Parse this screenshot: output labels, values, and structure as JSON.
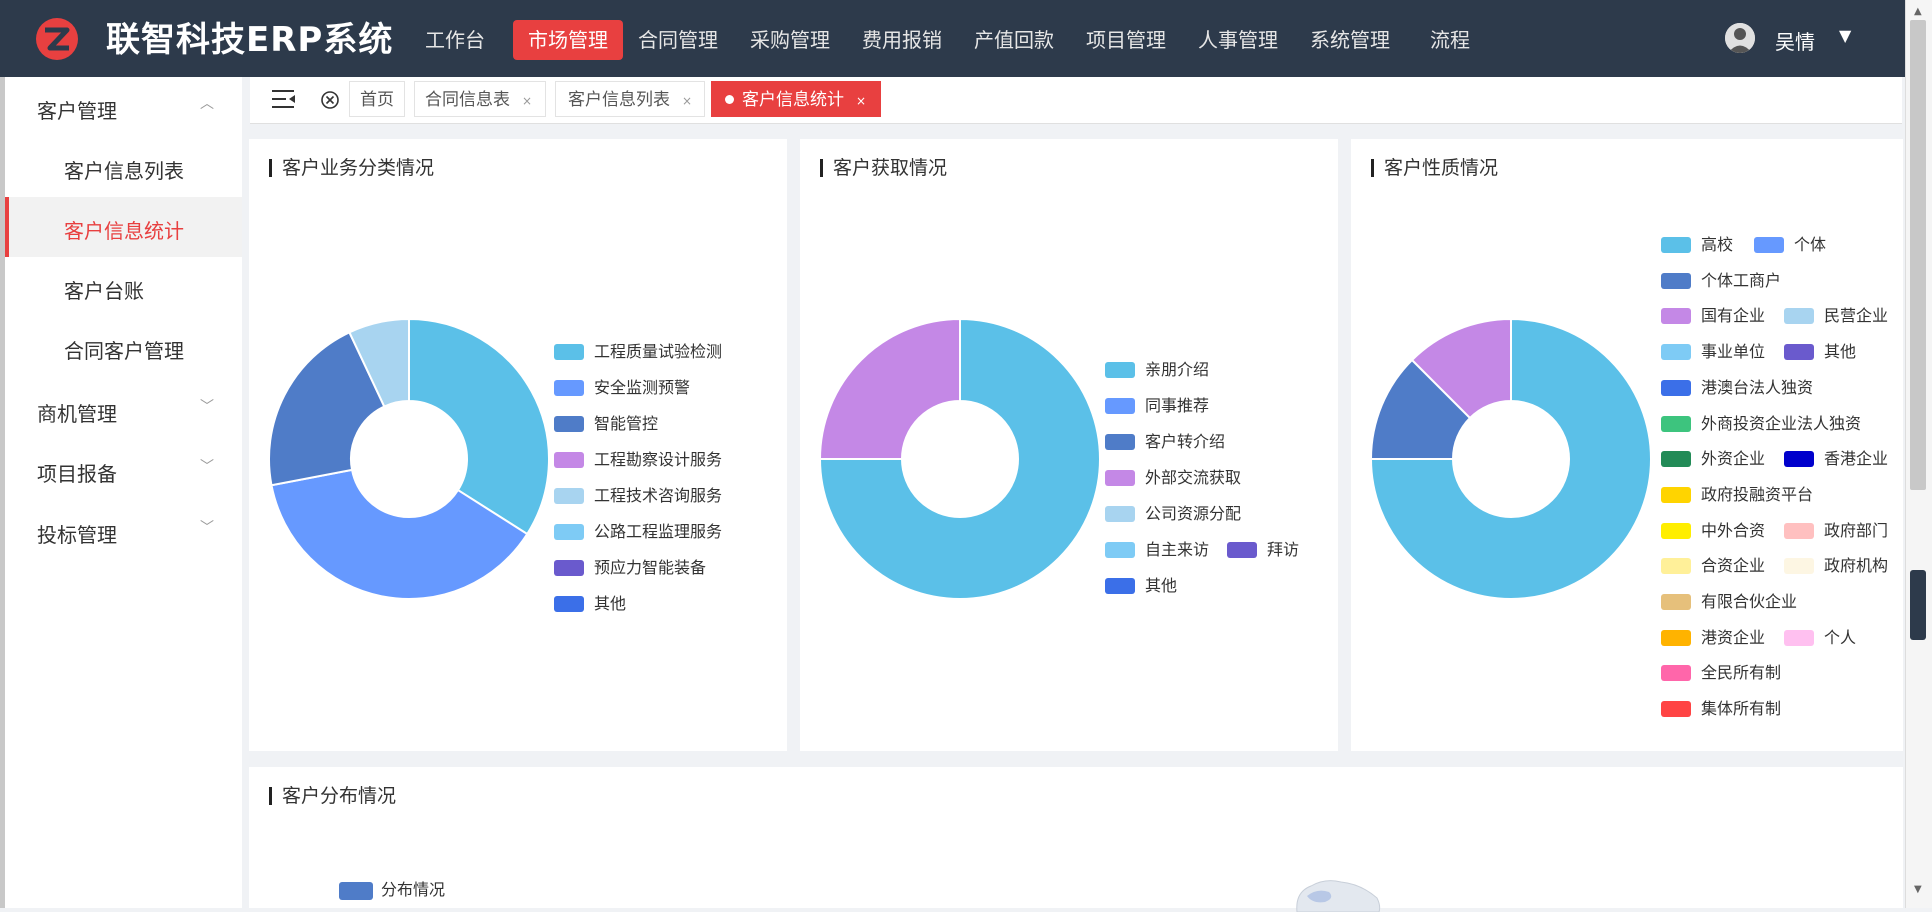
{
  "app": {
    "logo_text": "联智科技ERP系统"
  },
  "nav": {
    "items": [
      "工作台",
      "市场管理",
      "合同管理",
      "采购管理",
      "费用报销",
      "产值回款",
      "项目管理",
      "人事管理",
      "系统管理",
      "流程"
    ],
    "active_index": 1
  },
  "user": {
    "name": "吴情"
  },
  "sidebar": {
    "groups": [
      {
        "label": "客户管理",
        "expanded": true,
        "items": [
          "客户信息列表",
          "客户信息统计",
          "客户台账",
          "合同客户管理"
        ],
        "active_index": 1
      },
      {
        "label": "商机管理",
        "expanded": false
      },
      {
        "label": "项目报备",
        "expanded": false
      },
      {
        "label": "投标管理",
        "expanded": false
      }
    ]
  },
  "tabs": {
    "items": [
      "首页",
      "合同信息表",
      "客户信息列表",
      "客户信息统计"
    ],
    "active_index": 3
  },
  "colors": {
    "accent": "#e84040",
    "topbar": "#2d3a4b"
  },
  "charts": {
    "business": {
      "title": "客户业务分类情况",
      "chart_data": {
        "type": "pie",
        "donut": true,
        "categories": [
          "工程质量试验检测",
          "安全监测预警",
          "智能管控",
          "工程勘察设计服务",
          "工程技术咨询服务",
          "公路工程监理服务",
          "预应力智能装备",
          "其他"
        ],
        "values": [
          34,
          38,
          21,
          0,
          7,
          0,
          0,
          0
        ],
        "colors": [
          "#5bc0e8",
          "#6699ff",
          "#4f7cc8",
          "#c488e6",
          "#a8d4f0",
          "#7ecbf5",
          "#6a5acd",
          "#3b6fe8"
        ]
      }
    },
    "acquisition": {
      "title": "客户获取情况",
      "chart_data": {
        "type": "pie",
        "donut": true,
        "categories": [
          "亲朋介绍",
          "同事推荐",
          "客户转介绍",
          "外部交流获取",
          "公司资源分配",
          "自主来访",
          "拜访",
          "其他"
        ],
        "values": [
          75,
          0,
          0,
          25,
          0,
          0,
          0,
          0
        ],
        "colors": [
          "#5bc0e8",
          "#6699ff",
          "#4f7cc8",
          "#c488e6",
          "#a8d4f0",
          "#7ecbf5",
          "#6a5acd",
          "#3b6fe8"
        ]
      }
    },
    "nature": {
      "title": "客户性质情况",
      "chart_data": {
        "type": "pie",
        "donut": true,
        "categories": [
          "高校",
          "个体",
          "个体工商户",
          "国有企业",
          "民营企业",
          "事业单位",
          "其他",
          "港澳台法人独资",
          "外商投资企业法人独资",
          "外资企业",
          "香港企业",
          "政府投融资平台",
          "中外合资",
          "政府部门",
          "合资企业",
          "政府机构",
          "有限合伙企业",
          "港资企业",
          "个人",
          "全民所有制",
          "集体所有制"
        ],
        "values": [
          75,
          0,
          12.5,
          12.5,
          0,
          0,
          0,
          0,
          0,
          0,
          0,
          0,
          0,
          0,
          0,
          0,
          0,
          0,
          0,
          0,
          0
        ],
        "colors": [
          "#5bc0e8",
          "#6699ff",
          "#4f7cc8",
          "#c488e6",
          "#a8d4f0",
          "#7ecbf5",
          "#6a5acd",
          "#3b6fe8",
          "#3dc47e",
          "#228b57",
          "#0000cc",
          "#ffd400",
          "#ffee00",
          "#ffc0c0",
          "#fff099",
          "#fdf6e3",
          "#e6c07b",
          "#ffb300",
          "#ffc0f0",
          "#ff66aa",
          "#ff4444"
        ]
      }
    },
    "distribution": {
      "title": "客户分布情况",
      "legend_label": "分布情况",
      "legend_color": "#4f7cc8"
    }
  }
}
